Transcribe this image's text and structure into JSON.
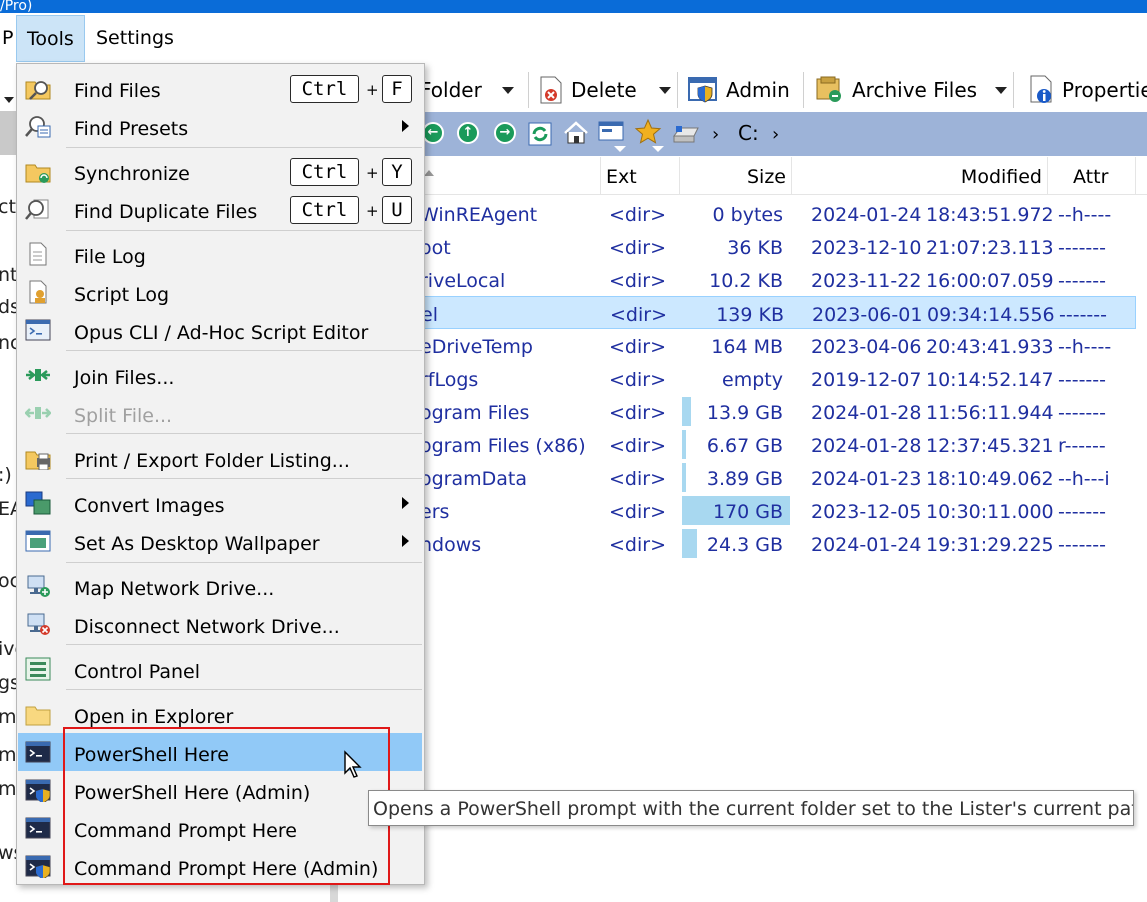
{
  "title_fragment": "/Pro)",
  "menubar": {
    "items": [
      "P",
      "Tools",
      "Settings"
    ]
  },
  "toolbar": {
    "folder_label": "Folder",
    "delete_label": "Delete",
    "admin_label": "Admin",
    "archive_label": "Archive Files",
    "properties_label": "Properties"
  },
  "pathbar": {
    "drive": "C:"
  },
  "columns": {
    "ext": "Ext",
    "size": "Size",
    "modified": "Modified",
    "attr": "Attr"
  },
  "files": [
    {
      "name": "WinREAgent",
      "ext": "<dir>",
      "size": "0 bytes",
      "date": "2024-01-24",
      "time": "18:43:51.972",
      "attr": "--h----",
      "bar": 0
    },
    {
      "name": "oot",
      "ext": "<dir>",
      "size": "36 KB",
      "date": "2023-12-10",
      "time": "21:07:23.113",
      "attr": "-------",
      "bar": 0
    },
    {
      "name": "riveLocal",
      "ext": "<dir>",
      "size": "10.2 KB",
      "date": "2023-11-22",
      "time": "16:00:07.059",
      "attr": "-------",
      "bar": 0
    },
    {
      "name": "el",
      "ext": "<dir>",
      "size": "139 KB",
      "date": "2023-06-01",
      "time": "09:34:14.556",
      "attr": "-------",
      "bar": 0,
      "selected": true
    },
    {
      "name": "eDriveTemp",
      "ext": "<dir>",
      "size": "164 MB",
      "date": "2023-04-06",
      "time": "20:43:41.933",
      "attr": "--h----",
      "bar": 0
    },
    {
      "name": "rfLogs",
      "ext": "<dir>",
      "size": "empty",
      "date": "2019-12-07",
      "time": "10:14:52.147",
      "attr": "-------",
      "bar": 0
    },
    {
      "name": "ogram Files",
      "ext": "<dir>",
      "size": "13.9 GB",
      "date": "2024-01-28",
      "time": "11:56:11.944",
      "attr": "-------",
      "bar": 0.08
    },
    {
      "name": "ogram Files (x86)",
      "ext": "<dir>",
      "size": "6.67 GB",
      "date": "2024-01-28",
      "time": "12:37:45.321",
      "attr": "r------",
      "bar": 0.04
    },
    {
      "name": "ogramData",
      "ext": "<dir>",
      "size": "3.89 GB",
      "date": "2024-01-23",
      "time": "18:10:49.062",
      "attr": "--h---i",
      "bar": 0.02
    },
    {
      "name": "ers",
      "ext": "<dir>",
      "size": "170 GB",
      "date": "2023-12-05",
      "time": "10:30:11.000",
      "attr": "-------",
      "bar": 1.0
    },
    {
      "name": "ndows",
      "ext": "<dir>",
      "size": "24.3 GB",
      "date": "2024-01-24",
      "time": "19:31:29.225",
      "attr": "-------",
      "bar": 0.14
    }
  ],
  "leftpane_fragments": [
    "cts",
    "nt",
    "ds",
    "nc",
    ":)",
    "EA",
    "oc",
    "ive",
    "gs",
    "m",
    "m",
    "m",
    "ws"
  ],
  "menu": {
    "items": [
      {
        "label": "Find Files",
        "shortcut": [
          "Ctrl",
          "F"
        ]
      },
      {
        "label": "Find Presets",
        "submenu": true
      },
      {
        "label": "Synchronize",
        "shortcut": [
          "Ctrl",
          "Y"
        ]
      },
      {
        "label": "Find Duplicate Files",
        "shortcut": [
          "Ctrl",
          "U"
        ]
      },
      {
        "label": "File Log"
      },
      {
        "label": "Script Log"
      },
      {
        "label": "Opus CLI / Ad-Hoc Script Editor"
      },
      {
        "label": "Join Files..."
      },
      {
        "label": "Split File...",
        "disabled": true
      },
      {
        "label": "Print / Export Folder Listing..."
      },
      {
        "label": "Convert Images",
        "submenu": true
      },
      {
        "label": "Set As Desktop Wallpaper",
        "submenu": true
      },
      {
        "label": "Map Network Drive..."
      },
      {
        "label": "Disconnect Network Drive..."
      },
      {
        "label": "Control Panel"
      },
      {
        "label": "Open in Explorer"
      },
      {
        "label": "PowerShell Here",
        "highlighted": true
      },
      {
        "label": "PowerShell Here (Admin)"
      },
      {
        "label": "Command Prompt Here"
      },
      {
        "label": "Command Prompt Here (Admin)"
      }
    ],
    "plus": "+"
  },
  "tooltip": "Opens a PowerShell prompt with the current folder set to the Lister's current path",
  "colors": {
    "titlebar": "#0a6cd8",
    "highlight": "#91c9f7",
    "selection": "#cce8ff",
    "redbox": "#e01818",
    "pathbar": "#9db3d8",
    "file_text": "#1f2fa0"
  }
}
